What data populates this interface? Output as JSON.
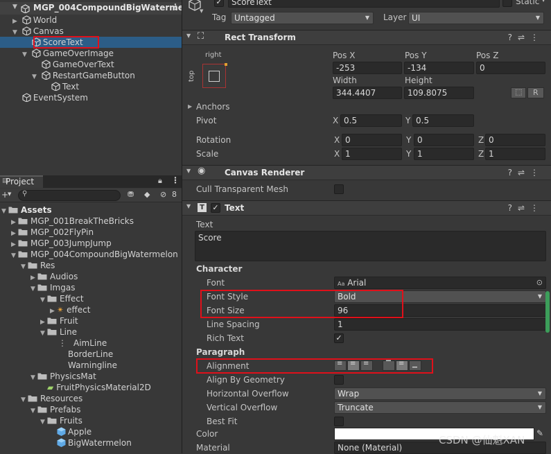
{
  "hierarchy": {
    "scene_name": "MGP_004CompoundBigWaterme",
    "items": [
      {
        "label": "World",
        "depth": 1,
        "expandable": true,
        "expanded": false
      },
      {
        "label": "Canvas",
        "depth": 1,
        "expandable": true,
        "expanded": true
      },
      {
        "label": "ScoreText",
        "depth": 2,
        "expandable": false,
        "selected": true
      },
      {
        "label": "GameOverImage",
        "depth": 2,
        "expandable": true,
        "expanded": true
      },
      {
        "label": "GameOverText",
        "depth": 3,
        "expandable": false
      },
      {
        "label": "RestartGameButton",
        "depth": 3,
        "expandable": true,
        "expanded": true
      },
      {
        "label": "Text",
        "depth": 4,
        "expandable": false
      },
      {
        "label": "EventSystem",
        "depth": 1,
        "expandable": false
      }
    ]
  },
  "project": {
    "tab_label": "Project",
    "hidden_count": "8",
    "items": [
      {
        "label": "Assets",
        "depth": 0,
        "type": "folder",
        "expanded": true,
        "bold": true
      },
      {
        "label": "MGP_001BreakTheBricks",
        "depth": 1,
        "type": "folder",
        "expanded": false
      },
      {
        "label": "MGP_002FlyPin",
        "depth": 1,
        "type": "folder",
        "expanded": false
      },
      {
        "label": "MGP_003JumpJump",
        "depth": 1,
        "type": "folder",
        "expanded": false
      },
      {
        "label": "MGP_004CompoundBigWatermelon",
        "depth": 1,
        "type": "folder",
        "expanded": true
      },
      {
        "label": "Res",
        "depth": 2,
        "type": "folder",
        "expanded": true
      },
      {
        "label": "Audios",
        "depth": 3,
        "type": "folder",
        "expanded": false
      },
      {
        "label": "Imgas",
        "depth": 3,
        "type": "folder",
        "expanded": true
      },
      {
        "label": "Effect",
        "depth": 4,
        "type": "folder",
        "expanded": true
      },
      {
        "label": "effect",
        "depth": 5,
        "type": "effect",
        "expanded": false
      },
      {
        "label": "Fruit",
        "depth": 4,
        "type": "folder",
        "expanded": false
      },
      {
        "label": "Line",
        "depth": 4,
        "type": "folder",
        "expanded": true
      },
      {
        "label": "AimLine",
        "depth": 5,
        "type": "sprite-line"
      },
      {
        "label": "BorderLine",
        "depth": 5,
        "type": "sprite"
      },
      {
        "label": "Warningline",
        "depth": 5,
        "type": "sprite"
      },
      {
        "label": "PhysicsMat",
        "depth": 3,
        "type": "folder",
        "expanded": true
      },
      {
        "label": "FruitPhysicsMaterial2D",
        "depth": 4,
        "type": "physics"
      },
      {
        "label": "Resources",
        "depth": 2,
        "type": "folder",
        "expanded": true
      },
      {
        "label": "Prefabs",
        "depth": 3,
        "type": "folder",
        "expanded": true
      },
      {
        "label": "Fruits",
        "depth": 4,
        "type": "folder",
        "expanded": true
      },
      {
        "label": "Apple",
        "depth": 5,
        "type": "prefab"
      },
      {
        "label": "BigWatermelon",
        "depth": 5,
        "type": "prefab"
      }
    ]
  },
  "inspector": {
    "object_name": "ScoreText",
    "static_label": "Static",
    "tag_label": "Tag",
    "tag_value": "Untagged",
    "layer_label": "Layer",
    "layer_value": "UI",
    "rect_transform": {
      "title": "Rect Transform",
      "anchor_h": "right",
      "anchor_v": "top",
      "pos_x_label": "Pos X",
      "pos_x": "-253",
      "pos_y_label": "Pos Y",
      "pos_y": "-134",
      "pos_z_label": "Pos Z",
      "pos_z": "0",
      "width_label": "Width",
      "width": "344.4407",
      "height_label": "Height",
      "height": "109.8075",
      "r_button": "R",
      "anchors_label": "Anchors",
      "pivot_label": "Pivot",
      "pivot_x": "0.5",
      "pivot_y": "0.5",
      "rotation_label": "Rotation",
      "rot_x": "0",
      "rot_y": "0",
      "rot_z": "0",
      "scale_label": "Scale",
      "scale_x": "1",
      "scale_y": "1",
      "scale_z": "1",
      "x": "X",
      "y": "Y",
      "z": "Z"
    },
    "canvas_renderer": {
      "title": "Canvas Renderer",
      "cull_label": "Cull Transparent Mesh"
    },
    "text": {
      "title": "Text",
      "text_label": "Text",
      "text_value": "Score",
      "character_label": "Character",
      "font_label": "Font",
      "font_value": "Arial",
      "font_prefix": "Aa",
      "font_style_label": "Font Style",
      "font_style_value": "Bold",
      "font_size_label": "Font Size",
      "font_size_value": "96",
      "line_spacing_label": "Line Spacing",
      "line_spacing_value": "1",
      "rich_text_label": "Rich Text",
      "paragraph_label": "Paragraph",
      "alignment_label": "Alignment",
      "align_geometry_label": "Align By Geometry",
      "horizontal_overflow_label": "Horizontal Overflow",
      "horizontal_overflow_value": "Wrap",
      "vertical_overflow_label": "Vertical Overflow",
      "vertical_overflow_value": "Truncate",
      "best_fit_label": "Best Fit",
      "color_label": "Color",
      "material_label": "Material",
      "material_value": "None (Material)"
    },
    "watermark": "CSDN @仙魁XAN",
    "colors": {
      "selection": "#2c5d87",
      "highlight": "#e0101a"
    }
  }
}
